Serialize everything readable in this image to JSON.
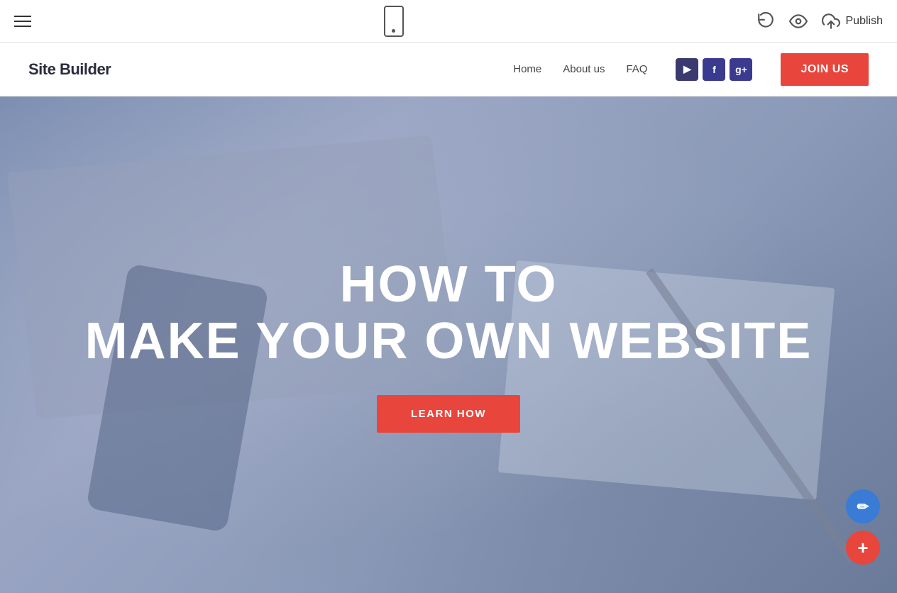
{
  "toolbar": {
    "publish_label": "Publish",
    "hamburger_label": "Menu"
  },
  "site_nav": {
    "logo": "Site Builder",
    "links": [
      {
        "label": "Home",
        "id": "home"
      },
      {
        "label": "About us",
        "id": "about"
      },
      {
        "label": "FAQ",
        "id": "faq"
      }
    ],
    "socials": [
      {
        "label": "YouTube",
        "id": "yt",
        "symbol": "▶"
      },
      {
        "label": "Facebook",
        "id": "fb",
        "symbol": "f"
      },
      {
        "label": "Google+",
        "id": "gp",
        "symbol": "g+"
      }
    ],
    "join_btn": "JOIN US"
  },
  "hero": {
    "title_line1": "HOW TO",
    "title_line2": "MAKE YOUR OWN WEBSITE",
    "cta_label": "LEARN HOW"
  },
  "fab": {
    "edit_symbol": "✏",
    "add_symbol": "+"
  }
}
